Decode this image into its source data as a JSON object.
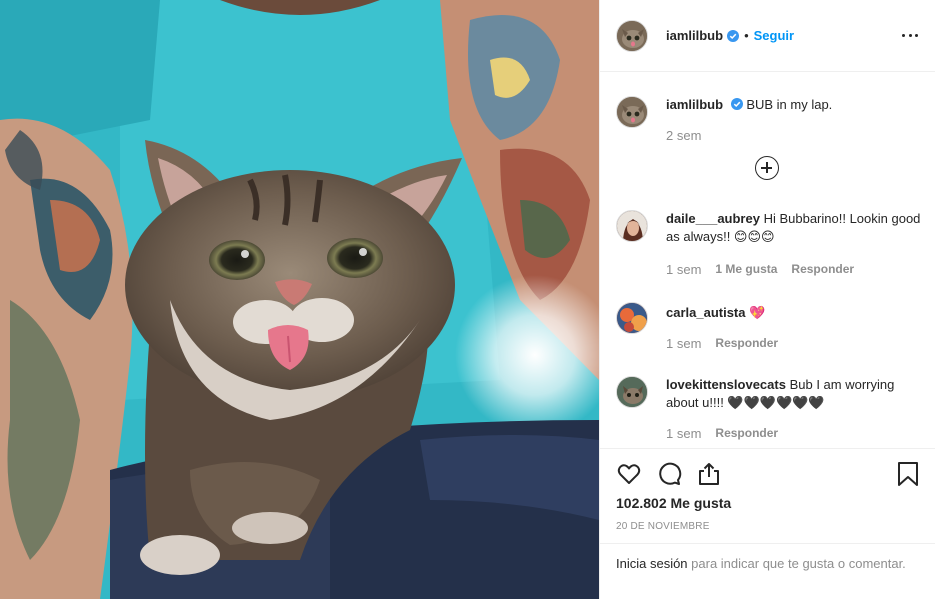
{
  "post": {
    "author": "iamlilbub",
    "dot": "•",
    "follow_label": "Seguir",
    "more_icon": "more-options-icon"
  },
  "caption": {
    "username": "iamlilbub",
    "text": "BUB in my lap.",
    "time": "2 sem"
  },
  "comments": [
    {
      "username": "daile___aubrey",
      "text": "Hi Bubbarino!! Lookin good as always!! 😊😊😊",
      "time": "1 sem",
      "likes": "1 Me gusta",
      "reply": "Responder"
    },
    {
      "username": "carla_autista",
      "text": "💖",
      "time": "1 sem",
      "reply": "Responder"
    },
    {
      "username": "lovekittenslovecats",
      "text": "Bub I am worrying about u!!!! 🖤🖤🖤🖤🖤🖤",
      "time": "1 sem",
      "reply": "Responder"
    }
  ],
  "stats": {
    "likes": "102.802 Me gusta",
    "date": "20 DE NOVIEMBRE"
  },
  "login": {
    "link": "Inicia sesión",
    "rest": " para indicar que te gusta o comentar."
  },
  "colors": {
    "link_blue": "#0095f6",
    "verified_blue": "#3897f0",
    "muted": "#8e8e8e"
  }
}
